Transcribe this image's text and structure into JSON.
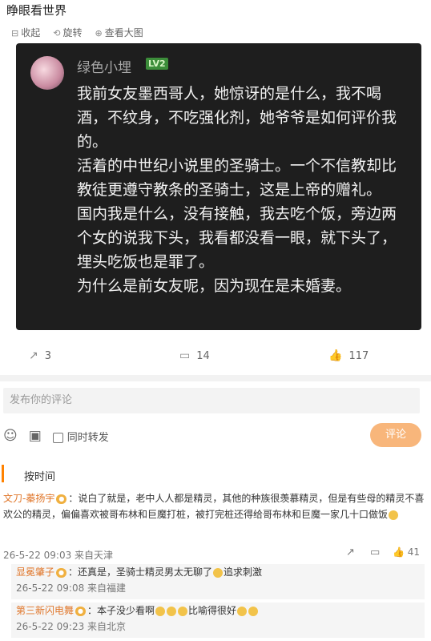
{
  "caption": "睁眼看世界",
  "toolbar": {
    "collect": "收起",
    "rotate": "旋转",
    "view_large": "查看大图"
  },
  "post": {
    "username": "绿色小埋",
    "level": "LV2",
    "paragraphs": [
      "我前女友墨西哥人，她惊讶的是什么，我不喝酒，不纹身，不吃强化剂，她爷爷是如何评价我的。",
      "活着的中世纪小说里的圣骑士。一个不信教却比教徒更遵守教条的圣骑士，这是上帝的赠礼。",
      "国内我是什么，没有接触，我去吃个饭，旁边两个女的说我下头，我看都没看一眼，就下头了，埋头吃饭也是罪了。",
      "为什么是前女友呢，因为现在是未婚妻。"
    ]
  },
  "stats": {
    "reposts": "3",
    "comments": "14",
    "likes": "117"
  },
  "composer": {
    "placeholder": "发布你的评论",
    "repost_label": "同时转发",
    "submit_label": "评论"
  },
  "sort": {
    "label": "按时间"
  },
  "comments": [
    {
      "author": "文刀-蓁扬宇",
      "text": "：说白了就是，老中人人都是精灵，其他的种族很羡慕精灵，但是有些母的精灵不喜欢公的精灵，偏偏喜欢被哥布林和巨魔打桩，被打完桩还得给哥布林和巨魔一家几十口做饭",
      "time": "26-5-22 09:03 来自天津",
      "likes": "41",
      "replies": [
        {
          "author": "显冕肇子",
          "text": "：还真是，圣骑士精灵男太无聊了",
          "tail": "追求刺激",
          "time": "26-5-22 09:08 来自福建"
        },
        {
          "author": "第三新闪电舞",
          "text": "：本子没少看啊",
          "tail": "比喻得很好",
          "time": "26-5-22 09:23 来自北京"
        }
      ]
    }
  ]
}
